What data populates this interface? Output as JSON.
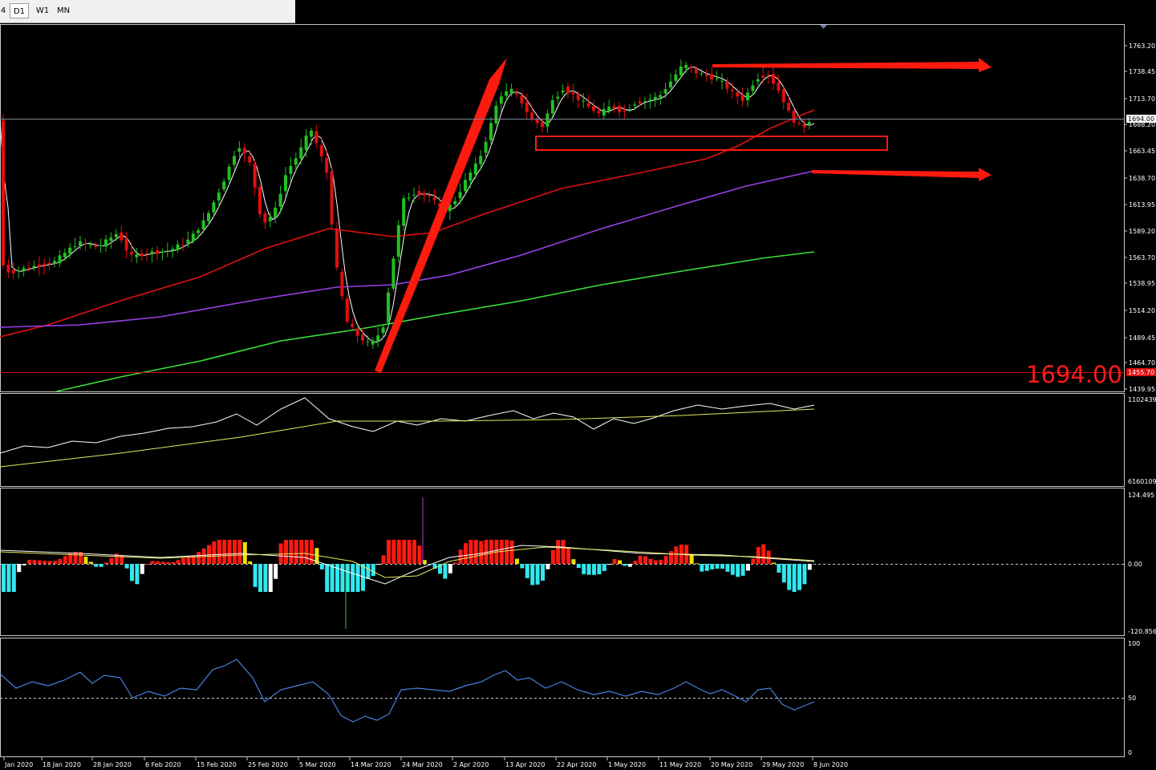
{
  "toolbar": {
    "timeframes": [
      {
        "label": "4",
        "active": false
      },
      {
        "label": "D1",
        "active": true
      },
      {
        "label": "W1",
        "active": false
      },
      {
        "label": "MN",
        "active": false
      }
    ]
  },
  "chart_data": {
    "type": "candlestick",
    "timeframe": "D1",
    "ylim": [
      1439.95,
      1763.2
    ],
    "price_ticks": [
      "1763.20",
      "1738.45",
      "1713.70",
      "1688.20",
      "1663.45",
      "1638.70",
      "1613.95",
      "1589.20",
      "1563.70",
      "1538.95",
      "1514.20",
      "1489.45",
      "1464.70",
      "1439.95"
    ],
    "current_price": "1694.00",
    "current_price_overlay": "1694.00",
    "low_line_label": "1455.70",
    "date_labels": [
      "Jan 2020",
      "18 Jan 2020",
      "28 Jan 2020",
      "6 Feb 2020",
      "15 Feb 2020",
      "25 Feb 2020",
      "5 Mar 2020",
      "14 Mar 2020",
      "24 Mar 2020",
      "2 Apr 2020",
      "13 Apr 2020",
      "22 Apr 2020",
      "1 May 2020",
      "11 May 2020",
      "20 May 2020",
      "29 May 2020",
      "8 Jun 2020"
    ],
    "colors": {
      "up": "#22c022",
      "down": "#e01010",
      "ma_fast": "#ffffff",
      "ma_mid": "#e01010",
      "ma_slow": "#9a40e8",
      "ma_long": "#38e038",
      "annotation": "#ff2010"
    },
    "subpanels": [
      {
        "name": "volume-obv",
        "ticks": [
          "1102439",
          "6160109"
        ]
      },
      {
        "name": "macd-histogram",
        "ticks": [
          "124.495",
          "0.00",
          "-120.856"
        ]
      },
      {
        "name": "rsi",
        "ticks": [
          "100",
          "50",
          "0"
        ]
      }
    ]
  }
}
